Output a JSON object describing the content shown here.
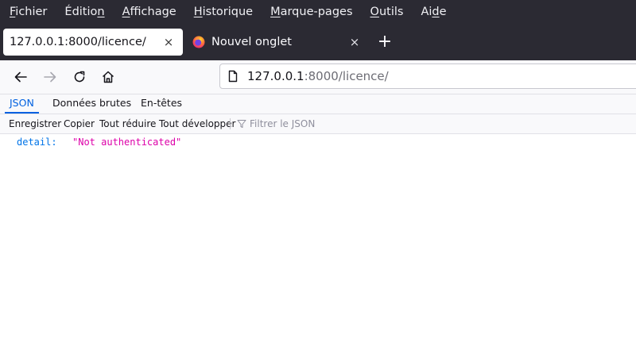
{
  "menu": {
    "items": [
      {
        "pre": "",
        "u": "F",
        "post": "ichier"
      },
      {
        "pre": "Éditio",
        "u": "n",
        "post": ""
      },
      {
        "pre": "",
        "u": "A",
        "post": "ffichage"
      },
      {
        "pre": "",
        "u": "H",
        "post": "istorique"
      },
      {
        "pre": "",
        "u": "M",
        "post": "arque-pages"
      },
      {
        "pre": "",
        "u": "O",
        "post": "utils"
      },
      {
        "pre": "Ai",
        "u": "d",
        "post": "e"
      }
    ]
  },
  "tabs": {
    "active": {
      "title": "127.0.0.1:8000/licence/",
      "close": "×"
    },
    "inactive": {
      "title": "Nouvel onglet",
      "close": "×"
    },
    "new_tab": "+"
  },
  "urlbar": {
    "host": "127.0.0.1",
    "rest": ":8000/licence/"
  },
  "viewer_tabs": [
    "JSON",
    "Données brutes",
    "En-têtes"
  ],
  "json_toolbar": {
    "save": "Enregistrer",
    "copy": "Copier",
    "collapse_all": "Tout réduire",
    "expand_all": "Tout développer",
    "filter_placeholder": "Filtrer le JSON"
  },
  "json": {
    "key": "detail:",
    "value": "\"Not authenticated\""
  },
  "colors": {
    "chrome_dark": "#2b2a33",
    "accent_blue": "#0061e0",
    "json_key": "#0074e8",
    "json_string": "#dd00a9"
  }
}
